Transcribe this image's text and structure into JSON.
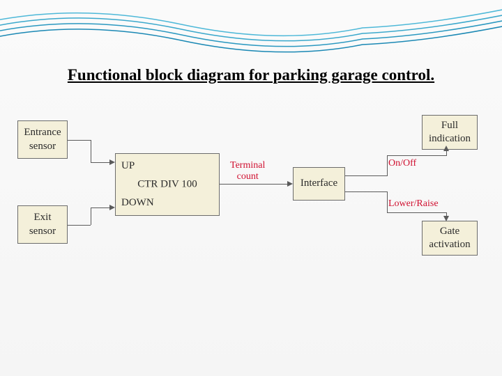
{
  "title": "Functional block diagram for parking garage control.",
  "blocks": {
    "entrance_sensor": "Entrance\nsensor",
    "exit_sensor": "Exit\nsensor",
    "ctr_up": "UP",
    "ctr_down": "DOWN",
    "ctr_center": "CTR DIV 100",
    "interface": "Interface",
    "full_indication": "Full\nindication",
    "gate_activation": "Gate\nactivation"
  },
  "labels": {
    "terminal_count": "Terminal\ncount",
    "on_off": "On/Off",
    "lower_raise": "Lower/Raise"
  }
}
